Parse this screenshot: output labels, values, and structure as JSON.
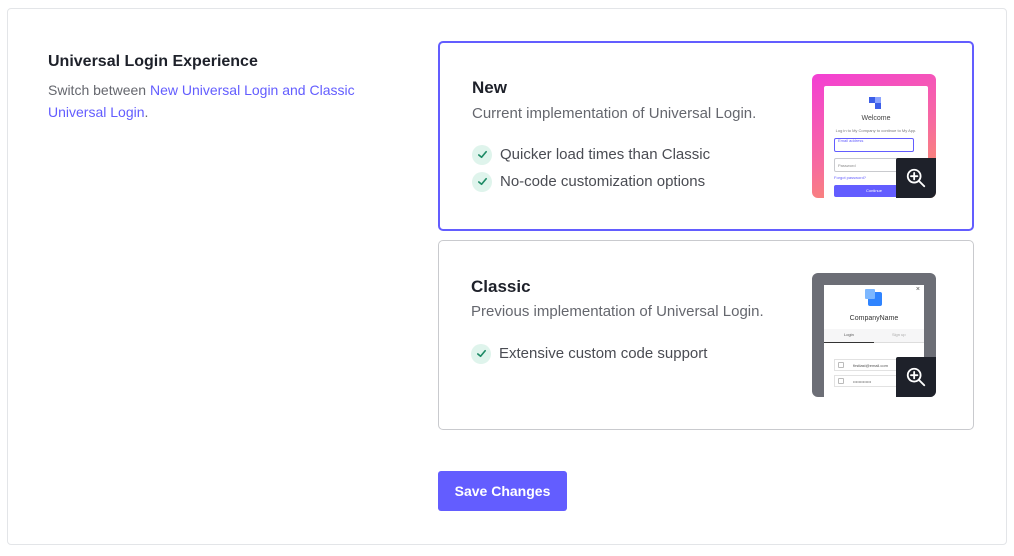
{
  "section": {
    "title": "Universal Login Experience",
    "description_prefix": "Switch between ",
    "description_link": "New Universal Login and Classic Universal Login",
    "description_suffix": "."
  },
  "options": [
    {
      "title": "New",
      "subtitle": "Current implementation of Universal Login.",
      "selected": true,
      "features": [
        "Quicker load times than Classic",
        "No-code customization options"
      ],
      "preview": {
        "heading": "Welcome",
        "intro": "Log in to My Company to continue to My App.",
        "email_label": "Email address",
        "password_placeholder": "Password",
        "forgot_link": "Forgot password?",
        "button": "Continue"
      }
    },
    {
      "title": "Classic",
      "subtitle": "Previous implementation of Universal Login.",
      "selected": false,
      "features": [
        "Extensive custom code support"
      ],
      "preview": {
        "company": "CompanyName",
        "tab_login": "Login",
        "tab_signup": "Sign up",
        "email": "firstlast@email.com",
        "password": "•••••••••••••",
        "close": "×"
      }
    }
  ],
  "actions": {
    "save_label": "Save Changes"
  },
  "colors": {
    "accent": "#635dff",
    "check_bg": "#dff4ec",
    "check": "#1e8a66"
  },
  "icons": {
    "check": "check-icon",
    "zoom": "zoom-in-icon",
    "logo": "auth0-logo-icon"
  }
}
